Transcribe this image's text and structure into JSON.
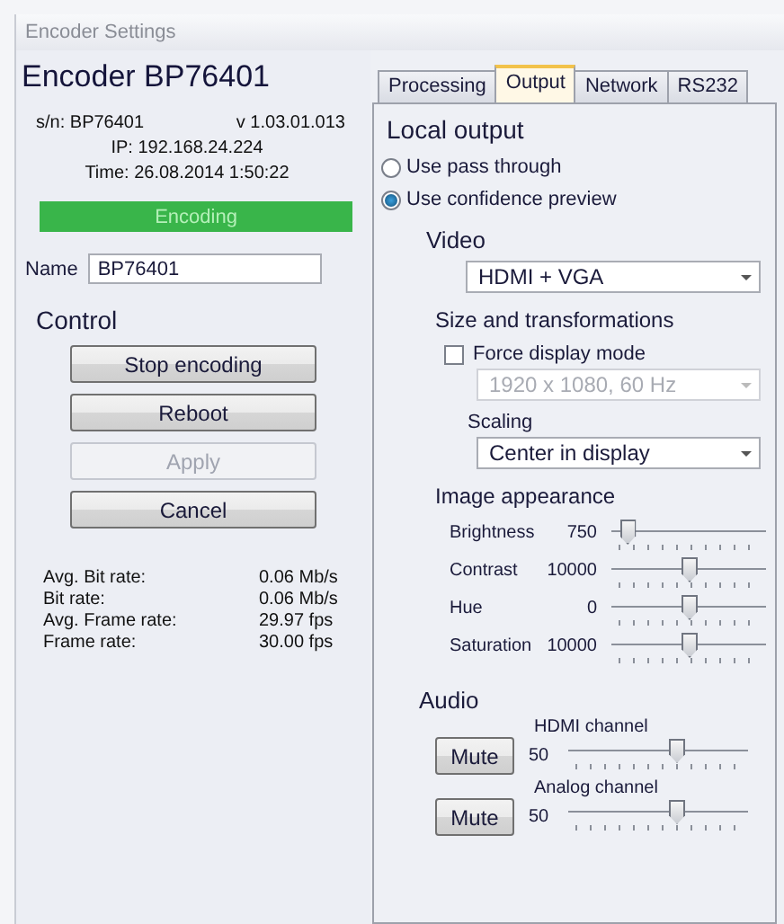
{
  "window": {
    "title": "Encoder Settings"
  },
  "device": {
    "heading": "Encoder BP76401",
    "serial": "s/n: BP76401",
    "version": "v 1.03.01.013",
    "ip": "IP:  192.168.24.224",
    "time": "Time: 26.08.2014 1:50:22",
    "status": "Encoding"
  },
  "name_field": {
    "label": "Name",
    "value": "BP76401"
  },
  "control": {
    "heading": "Control",
    "buttons": [
      {
        "label": "Stop encoding",
        "disabled": false
      },
      {
        "label": "Reboot",
        "disabled": false
      },
      {
        "label": "Apply",
        "disabled": true
      },
      {
        "label": "Cancel",
        "disabled": false
      }
    ]
  },
  "stats": [
    {
      "label": "Avg. Bit rate:",
      "value": "0.06 Mb/s"
    },
    {
      "label": "Bit rate:",
      "value": "0.06 Mb/s"
    },
    {
      "label": "Avg. Frame rate:",
      "value": "29.97 fps"
    },
    {
      "label": "Frame rate:",
      "value": "30.00 fps"
    }
  ],
  "tabs": [
    {
      "label": "Processing",
      "selected": false
    },
    {
      "label": "Output",
      "selected": true
    },
    {
      "label": "Network",
      "selected": false
    },
    {
      "label": "RS232",
      "selected": false
    }
  ],
  "local_output": {
    "heading": "Local output",
    "options": [
      {
        "label": "Use pass through",
        "selected": false
      },
      {
        "label": "Use confidence preview",
        "selected": true
      }
    ]
  },
  "video": {
    "heading": "Video",
    "output": {
      "value": "HDMI + VGA",
      "disabled": false
    },
    "size_heading": "Size and transformations",
    "force_display_mode": {
      "label": "Force display mode",
      "checked": false
    },
    "display_mode": {
      "value": "1920 x 1080, 60 Hz",
      "disabled": true
    },
    "scaling": {
      "label": "Scaling",
      "value": "Center in display",
      "disabled": false
    }
  },
  "image_appearance": {
    "heading": "Image appearance",
    "controls": [
      {
        "label": "Brightness",
        "value": "750",
        "level": 0.1
      },
      {
        "label": "Contrast",
        "value": "10000",
        "level": 0.5
      },
      {
        "label": "Hue",
        "value": "0",
        "level": 0.5
      },
      {
        "label": "Saturation",
        "value": "10000",
        "level": 0.5
      }
    ]
  },
  "audio": {
    "heading": "Audio",
    "channels": [
      {
        "name": "HDMI channel",
        "mute_label": "Mute",
        "value": "50",
        "level": 0.6
      },
      {
        "name": "Analog channel",
        "mute_label": "Mute",
        "value": "50",
        "level": 0.6
      }
    ]
  }
}
